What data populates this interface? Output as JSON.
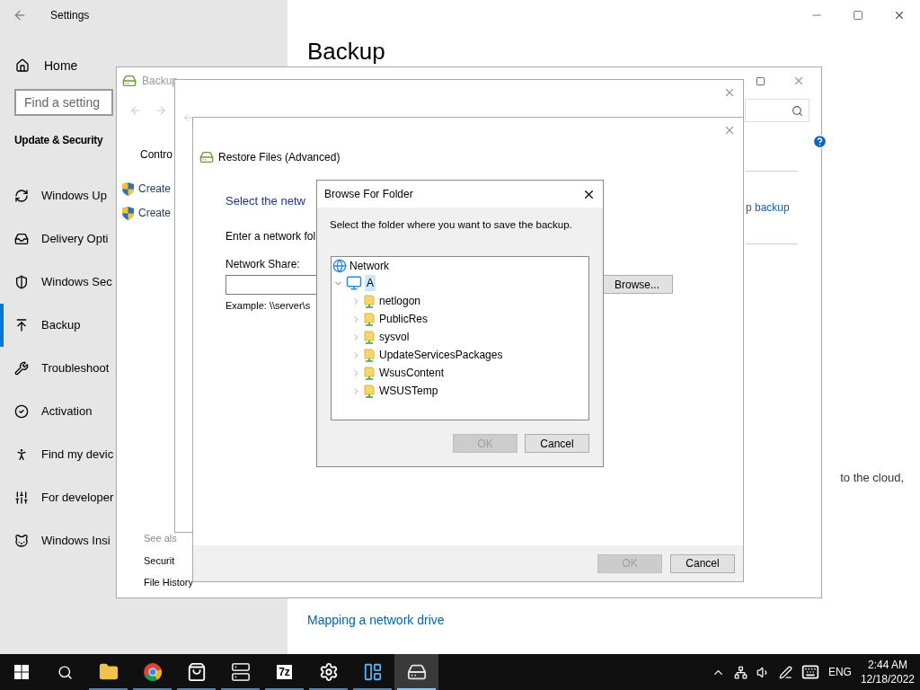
{
  "settings": {
    "title": "Settings",
    "home": "Home",
    "search": {
      "placeholder": "Find a setting"
    },
    "section": "Update & Security",
    "nav": [
      {
        "label": "Windows Up",
        "selected": false
      },
      {
        "label": "Delivery Opti",
        "selected": false
      },
      {
        "label": "Windows Sec",
        "selected": false
      },
      {
        "label": "Backup",
        "selected": true
      },
      {
        "label": "Troubleshoot",
        "selected": false
      },
      {
        "label": "Activation",
        "selected": false
      },
      {
        "label": "Find my devic",
        "selected": false
      },
      {
        "label": "For developer",
        "selected": false
      },
      {
        "label": "Windows Insi",
        "selected": false
      }
    ],
    "heading": "Backup",
    "text_fragment": "to the cloud,",
    "link": "Mapping a network drive"
  },
  "backup_window": {
    "title": "Backup",
    "sidebar_link": "Contro",
    "tasks": [
      "Create",
      "Create"
    ],
    "see_also": "See als",
    "see_also_links": [
      "Securit",
      "File History"
    ],
    "right_link": "p backup"
  },
  "restore_window": {
    "title": "Restore Files (Advanced)",
    "heading": "Select the netw",
    "instruction": "Enter a network fol",
    "field_label": "Network Share:",
    "example": "Example: \\\\server\\s",
    "browse_button": "Browse...",
    "buttons": [
      {
        "label": "OK",
        "disabled": true
      },
      {
        "label": "Cancel",
        "disabled": false
      }
    ]
  },
  "browse_dialog": {
    "title": "Browse For Folder",
    "prompt": "Select the folder where you want to save the backup.",
    "tree": {
      "label": "Network",
      "children": [
        {
          "label": "A",
          "expanded": true,
          "selected": true,
          "children": [
            {
              "label": "netlogon",
              "expanded": false,
              "selected": false
            },
            {
              "label": "PublicRes",
              "expanded": false,
              "selected": false
            },
            {
              "label": "sysvol",
              "expanded": false,
              "selected": false
            },
            {
              "label": "UpdateServicesPackages",
              "expanded": false,
              "selected": false
            },
            {
              "label": "WsusContent",
              "expanded": false,
              "selected": false
            },
            {
              "label": "WSUSTemp",
              "expanded": false,
              "selected": false
            }
          ]
        }
      ]
    },
    "buttons": [
      {
        "label": "OK",
        "disabled": true
      },
      {
        "label": "Cancel",
        "disabled": false
      }
    ]
  },
  "taskbar": {
    "apps": [
      {
        "kind": "folder",
        "running": true,
        "selected": false
      },
      {
        "kind": "browser",
        "running": true,
        "selected": false
      },
      {
        "kind": "store",
        "running": true,
        "selected": false
      },
      {
        "kind": "server",
        "running": true,
        "selected": false
      },
      {
        "kind": "archive",
        "label": "7z",
        "running": true,
        "selected": false
      },
      {
        "kind": "settings",
        "running": true,
        "selected": false
      },
      {
        "kind": "panel",
        "running": true,
        "selected": false
      },
      {
        "kind": "backup",
        "running": true,
        "selected": true
      }
    ],
    "tray": {
      "language": "ENG",
      "time": "2:44 AM",
      "date": "12/18/2022"
    }
  }
}
